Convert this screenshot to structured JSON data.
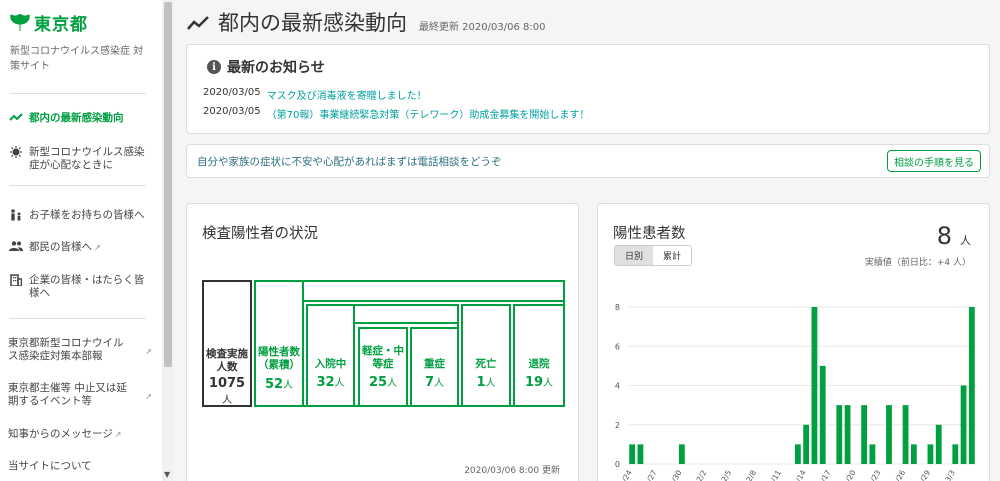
{
  "sidebar": {
    "logo_text": "東京都",
    "site_name": "新型コロナウイルス感染症 対策サイト",
    "nav": [
      {
        "label": "都内の最新感染動向",
        "icon": "trend-icon",
        "active": true
      },
      {
        "label": "新型コロナウイルス感染症が心配なときに",
        "icon": "virus-icon"
      },
      {
        "label": "お子様をお持ちの皆様へ",
        "icon": "family-icon"
      },
      {
        "label": "都民の皆様へ",
        "icon": "people-icon",
        "external": true
      },
      {
        "label": "企業の皆様・はたらく皆様へ",
        "icon": "building-icon"
      },
      {
        "label": "東京都新型コロナウイルス感染症対策本部報",
        "external": true
      },
      {
        "label": "東京都主催等 中止又は延期するイベント等",
        "external": true
      },
      {
        "label": "知事からのメッセージ",
        "external": true
      },
      {
        "label": "当サイトについて"
      }
    ]
  },
  "header": {
    "title": "都内の最新感染動向",
    "updated": "最終更新 2020/03/06 8:00"
  },
  "news": {
    "title": "最新のお知らせ",
    "items": [
      {
        "date": "2020/03/05",
        "text": "マスク及び消毒液を寄贈しました！"
      },
      {
        "date": "2020/03/05",
        "text": "（第70報）事業継続緊急対策（テレワーク）助成金募集を開始します！"
      }
    ]
  },
  "consult": {
    "text": "自分や家族の症状に不安や心配があればまずは電話相談をどうぞ",
    "button": "相談の手順を見る"
  },
  "inspection": {
    "title": "検査陽性者の状況",
    "updated": "2020/03/06 8:00 更新",
    "boxes": {
      "tested": {
        "label": "検査実施人数",
        "value": "1075",
        "unit": "人"
      },
      "positive": {
        "label": "陽性者数（累積）",
        "value": "52",
        "unit": "人"
      },
      "hospitalized": {
        "label": "入院中",
        "value": "32",
        "unit": "人"
      },
      "mild": {
        "label": "軽症・中等症",
        "value": "25",
        "unit": "人"
      },
      "severe": {
        "label": "重症",
        "value": "7",
        "unit": "人"
      },
      "death": {
        "label": "死亡",
        "value": "1",
        "unit": "人"
      },
      "discharged": {
        "label": "退院",
        "value": "19",
        "unit": "人"
      }
    }
  },
  "positive_card": {
    "title": "陽性患者数",
    "count": "8",
    "unit": "人",
    "sub": "実績値（前日比：+4 人）",
    "toggle": [
      "日別",
      "累計"
    ],
    "accent": "#00a040"
  },
  "chart_data": {
    "type": "bar",
    "categories": [
      "1/24",
      "1/25",
      "1/26",
      "1/27",
      "1/28",
      "1/29",
      "1/30",
      "1/31",
      "2/1",
      "2/2",
      "2/3",
      "2/4",
      "2/5",
      "2/6",
      "2/7",
      "2/8",
      "2/9",
      "2/10",
      "2/11",
      "2/12",
      "2/13",
      "2/14",
      "2/15",
      "2/16",
      "2/17",
      "2/18",
      "2/19",
      "2/20",
      "2/21",
      "2/22",
      "2/23",
      "2/24",
      "2/25",
      "2/26",
      "2/27",
      "2/28",
      "2/29",
      "3/1",
      "3/2",
      "3/3",
      "3/4",
      "3/5"
    ],
    "tick_labels": [
      "1/24",
      "1/27",
      "1/30",
      "2/2",
      "2/5",
      "2/8",
      "2/11",
      "2/14",
      "2/17",
      "2/20",
      "2/23",
      "2/26",
      "2/29",
      "3/3"
    ],
    "values": [
      1,
      1,
      0,
      0,
      0,
      0,
      1,
      0,
      0,
      0,
      0,
      0,
      0,
      0,
      0,
      0,
      0,
      0,
      0,
      0,
      1,
      2,
      8,
      5,
      0,
      3,
      3,
      0,
      3,
      1,
      0,
      3,
      0,
      3,
      1,
      0,
      1,
      2,
      0,
      1,
      4,
      8
    ],
    "yticks": [
      0,
      2,
      4,
      6,
      8
    ],
    "ylim": [
      0,
      8
    ],
    "color": "#00a040"
  }
}
